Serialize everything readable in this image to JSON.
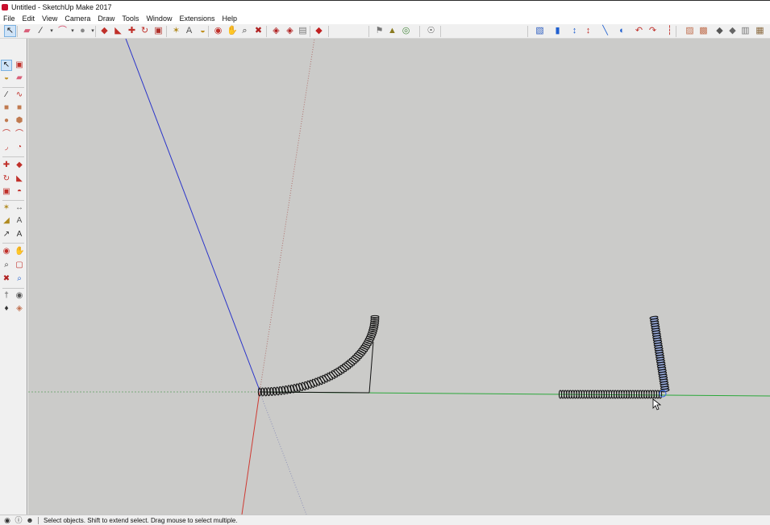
{
  "window": {
    "title": "Untitled - SketchUp Make 2017"
  },
  "menu": [
    "File",
    "Edit",
    "View",
    "Camera",
    "Draw",
    "Tools",
    "Window",
    "Extensions",
    "Help"
  ],
  "toolbar": {
    "tools": [
      {
        "name": "select-tool-button",
        "glyph": "↖",
        "color": "#1a1a1a",
        "active": true
      },
      {
        "name": "eraser-button",
        "glyph": "▰",
        "color": "#d9607a"
      },
      {
        "name": "line-tool-button",
        "glyph": "∕",
        "color": "#222"
      },
      {
        "name": "freehand-dropdown-icon",
        "glyph": "▾",
        "color": "#444"
      },
      {
        "name": "arc-tool-button",
        "glyph": "⌒",
        "color": "#d04060"
      },
      {
        "name": "arc-dropdown-icon",
        "glyph": "▾",
        "color": "#444"
      },
      {
        "name": "shapes-tool-button",
        "glyph": "●",
        "color": "#888"
      },
      {
        "name": "shapes-dropdown-icon",
        "glyph": "▾",
        "color": "#444"
      },
      {
        "name": "push-pull-button",
        "glyph": "◆",
        "color": "#c0302a"
      },
      {
        "name": "follow-me-button",
        "glyph": "◣",
        "color": "#c0302a"
      },
      {
        "name": "move-tool-button",
        "glyph": "✚",
        "color": "#c0302a"
      },
      {
        "name": "rotate-tool-button",
        "glyph": "↻",
        "color": "#c0302a"
      },
      {
        "name": "scale-tool-button",
        "glyph": "▣",
        "color": "#b0302a"
      },
      {
        "name": "tape-measure-button",
        "glyph": "✶",
        "color": "#b08a20"
      },
      {
        "name": "text-tool-button",
        "glyph": "A",
        "color": "#555"
      },
      {
        "name": "paint-bucket-button",
        "glyph": "◒",
        "color": "#c09020"
      },
      {
        "name": "orbit-tool-button",
        "glyph": "◉",
        "color": "#c0302a"
      },
      {
        "name": "pan-tool-button",
        "glyph": "✋",
        "color": "#c08a3a"
      },
      {
        "name": "zoom-tool-button",
        "glyph": "⌕",
        "color": "#333"
      },
      {
        "name": "zoom-extents-button",
        "glyph": "✖",
        "color": "#b02020"
      },
      {
        "name": "warehouse-button",
        "glyph": "◈",
        "color": "#b02020"
      },
      {
        "name": "extension-warehouse-button",
        "glyph": "◈",
        "color": "#b02020"
      },
      {
        "name": "layout-send-button",
        "glyph": "▤",
        "color": "#777"
      },
      {
        "name": "extension-manager-button",
        "glyph": "◆",
        "color": "#c02020"
      },
      {
        "name": "add-location-button",
        "glyph": "⚑",
        "color": "#777"
      },
      {
        "name": "toggle-terrain-button",
        "glyph": "▲",
        "color": "#8a7a20"
      },
      {
        "name": "photo-texture-button",
        "glyph": "◎",
        "color": "#4a8a40"
      },
      {
        "name": "sandbox-button",
        "glyph": "☉",
        "color": "#555"
      }
    ],
    "views": [
      {
        "name": "iso-view-button",
        "glyph": "▧",
        "color": "#3060c0"
      },
      {
        "name": "top-view-button",
        "glyph": "▮",
        "color": "#1f5fd0"
      },
      {
        "name": "front-view-button",
        "glyph": "↕",
        "color": "#1f5fd0"
      },
      {
        "name": "right-view-button",
        "glyph": "↕",
        "color": "#c0302a"
      },
      {
        "name": "back-view-button",
        "glyph": "╲",
        "color": "#1f5fd0"
      },
      {
        "name": "left-view-button",
        "glyph": "◐",
        "color": "#1f5fd0"
      },
      {
        "name": "section-plane-button",
        "glyph": "↶",
        "color": "#c0302a"
      },
      {
        "name": "section-cut-button",
        "glyph": "↷",
        "color": "#c0302a"
      },
      {
        "name": "section-fill-button",
        "glyph": "┆",
        "color": "#c0302a"
      },
      {
        "name": "xray-style-button",
        "glyph": "▨",
        "color": "#c07050"
      },
      {
        "name": "back-edges-style-button",
        "glyph": "▩",
        "color": "#c07050"
      },
      {
        "name": "wireframe-style-button",
        "glyph": "◆",
        "color": "#555"
      },
      {
        "name": "hidden-line-style-button",
        "glyph": "◆",
        "color": "#666"
      },
      {
        "name": "shaded-style-button",
        "glyph": "▥",
        "color": "#777"
      },
      {
        "name": "textured-style-button",
        "glyph": "▦",
        "color": "#8a6a40"
      }
    ]
  },
  "left_toolbar": [
    [
      "select-tool-button",
      "↖",
      "#111",
      "component-tool-button",
      "▣",
      "#c0302a"
    ],
    [
      "paint-tool-button",
      "◒",
      "#c09020",
      "eraser-tool-button",
      "▰",
      "#d9607a"
    ],
    [
      "line-tool-button",
      "∕",
      "#222",
      "freehand-tool-button",
      "∿",
      "#c0302a"
    ],
    [
      "rectangle-tool-button",
      "■",
      "#c07a50",
      "rotated-rect-tool-button",
      "■",
      "#c07a50"
    ],
    [
      "circle-tool-button",
      "●",
      "#c07a50",
      "polygon-tool-button",
      "⬢",
      "#c07a50"
    ],
    [
      "arc-tool-button",
      "⌒",
      "#c0302a",
      "two-point-arc-button",
      "⌒",
      "#c0302a"
    ],
    [
      "three-point-arc-button",
      "◞",
      "#c0302a",
      "pie-tool-button",
      "◔",
      "#c0302a"
    ],
    [
      "move-tool-button",
      "✚",
      "#c0302a",
      "push-pull-tool-button",
      "◆",
      "#c0302a"
    ],
    [
      "rotate-tool-button",
      "↻",
      "#c0302a",
      "follow-me-tool-button",
      "◣",
      "#c0302a"
    ],
    [
      "scale-tool-button",
      "▣",
      "#c0302a",
      "offset-tool-button",
      "◓",
      "#c0302a"
    ],
    [
      "tape-measure-tool-button",
      "✶",
      "#b08a20",
      "dimension-tool-button",
      "↔",
      "#666"
    ],
    [
      "protractor-tool-button",
      "◢",
      "#b08a20",
      "text-tool-button",
      "A",
      "#555"
    ],
    [
      "axes-tool-button",
      "↗",
      "#333",
      "3d-text-tool-button",
      "A",
      "#333"
    ],
    [
      "orbit-tool-button",
      "◉",
      "#c0302a",
      "pan-tool-button",
      "✋",
      "#c08a3a"
    ],
    [
      "zoom-tool-button",
      "⌕",
      "#333",
      "zoom-window-button",
      "▢",
      "#c0302a"
    ],
    [
      "zoom-extents-tool-button",
      "✖",
      "#b02020",
      "previous-view-button",
      "⌕",
      "#1f5fd0"
    ],
    [
      "position-camera-button",
      "†",
      "#555",
      "look-around-button",
      "◉",
      "#555"
    ],
    [
      "walk-tool-button",
      "♦",
      "#333",
      "section-plane-tool-button",
      "◈",
      "#c07050"
    ]
  ],
  "status": {
    "hint": "Select objects. Shift to extend select. Drag mouse to select multiple.",
    "icons": [
      "geolocation-icon",
      "credits-icon",
      "user-account-icon"
    ]
  },
  "colors": {
    "viewport_bg": "#cbcbc9",
    "blue_axis": "#2a34c9",
    "red_axis": "#cf3a32",
    "green_axis": "#2ba83a",
    "geometry": "#111111",
    "selection": "#2f5fe0"
  }
}
